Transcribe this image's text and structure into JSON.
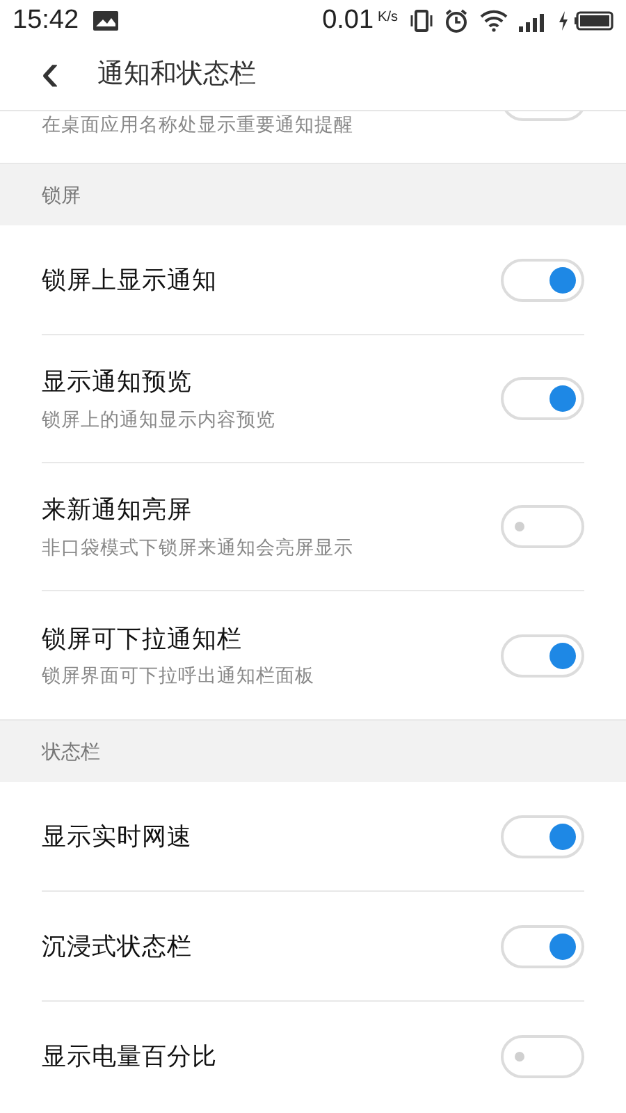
{
  "status_bar": {
    "time": "15:42",
    "speed": "0.01",
    "speed_unit": "K/s"
  },
  "header": {
    "back": "‹",
    "title": "通知和状态栏"
  },
  "partial_row": {
    "subtitle": "在桌面应用名称处显示重要通知提醒"
  },
  "sections": [
    {
      "title": "锁屏",
      "rows": [
        {
          "title": "锁屏上显示通知",
          "on": true
        },
        {
          "title": "显示通知预览",
          "subtitle": "锁屏上的通知显示内容预览",
          "on": true
        },
        {
          "title": "来新通知亮屏",
          "subtitle": "非口袋模式下锁屏来通知会亮屏显示",
          "on": false
        },
        {
          "title": "锁屏可下拉通知栏",
          "subtitle": "锁屏界面可下拉呼出通知栏面板",
          "on": true
        }
      ]
    },
    {
      "title": "状态栏",
      "rows": [
        {
          "title": "显示实时网速",
          "on": true
        },
        {
          "title": "沉浸式状态栏",
          "on": true
        },
        {
          "title": "显示电量百分比",
          "on": false
        }
      ]
    }
  ]
}
